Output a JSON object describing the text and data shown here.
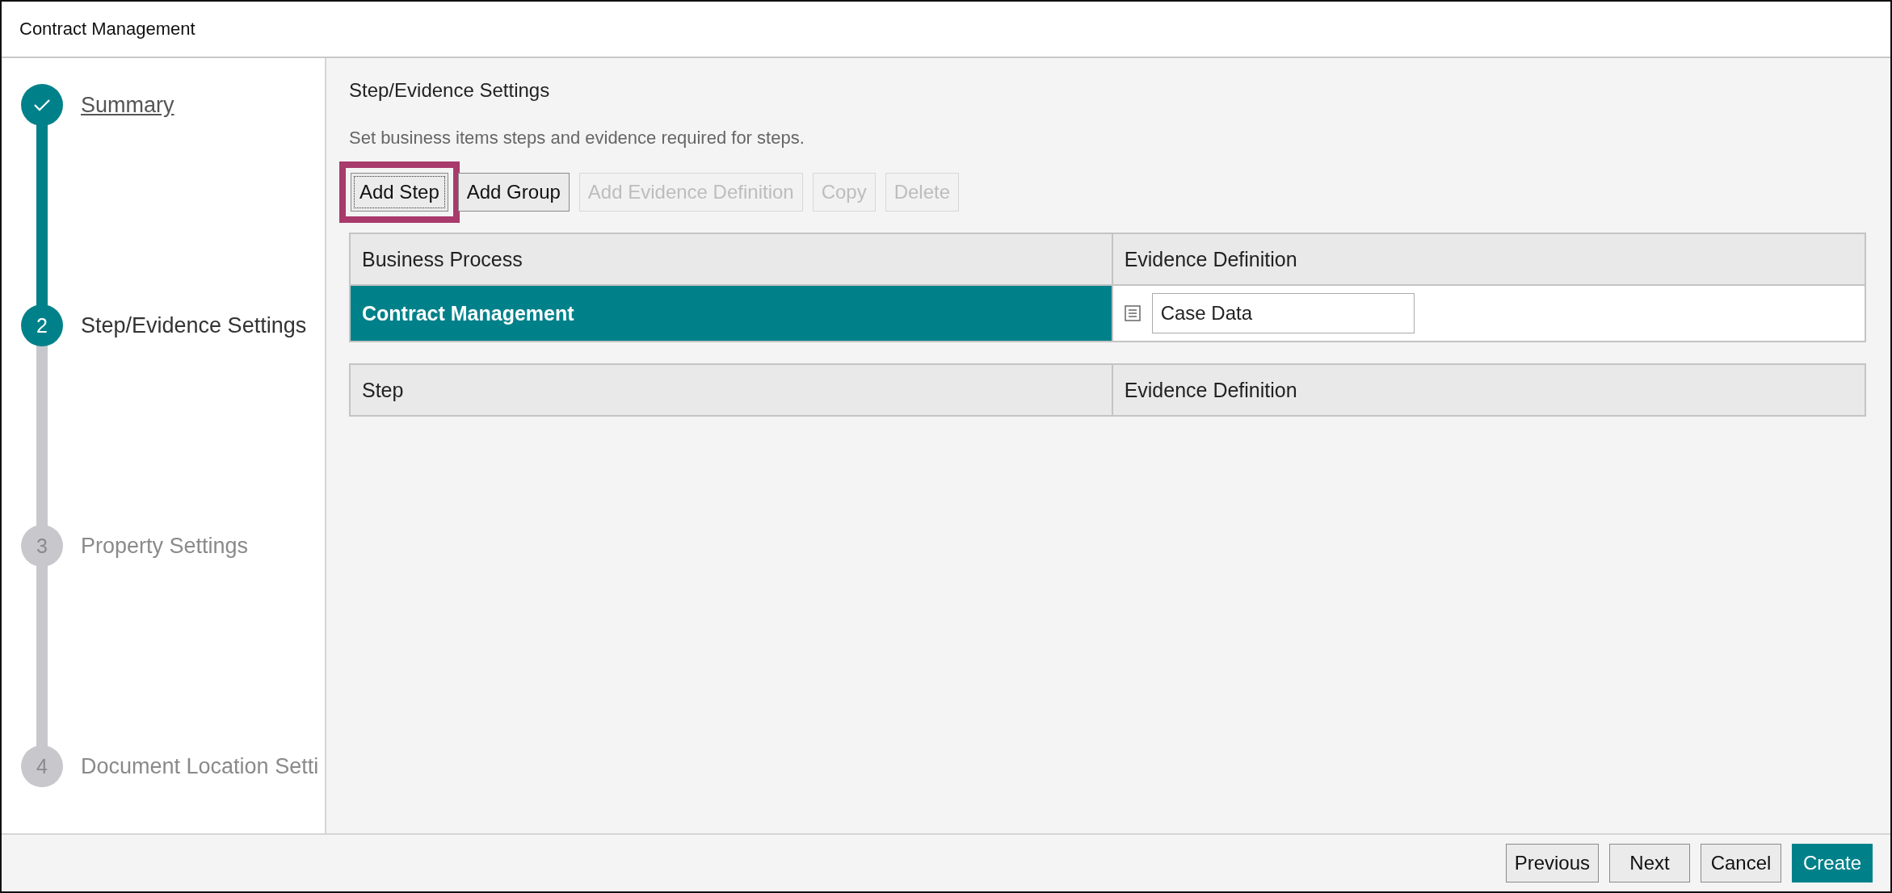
{
  "window": {
    "title": "Contract Management"
  },
  "steps": [
    {
      "kind": "done",
      "label": "Summary"
    },
    {
      "kind": "current",
      "number": "2",
      "label": "Step/Evidence Settings"
    },
    {
      "kind": "pending",
      "number": "3",
      "label": "Property Settings"
    },
    {
      "kind": "pending",
      "number": "4",
      "label": "Document Location Setti"
    }
  ],
  "panel": {
    "title": "Step/Evidence Settings",
    "description": "Set business items steps and evidence required for steps.",
    "toolbar": [
      {
        "label": "Add Step",
        "disabled": false,
        "highlighted": true
      },
      {
        "label": "Add Group",
        "disabled": false,
        "highlighted": false
      },
      {
        "label": "Add Evidence Definition",
        "disabled": true,
        "highlighted": false
      },
      {
        "label": "Copy",
        "disabled": true,
        "highlighted": false
      },
      {
        "label": "Delete",
        "disabled": true,
        "highlighted": false
      }
    ],
    "process_table": {
      "columns": [
        "Business Process",
        "Evidence Definition"
      ],
      "rows": [
        {
          "name": "Contract Management",
          "selected": true,
          "evidence": "Case Data"
        }
      ]
    },
    "step_table": {
      "columns": [
        "Step",
        "Evidence Definition"
      ]
    }
  },
  "footer": {
    "buttons": [
      {
        "label": "Previous",
        "kind": "normal"
      },
      {
        "label": "Next",
        "kind": "normal"
      },
      {
        "label": "Cancel",
        "kind": "normal"
      },
      {
        "label": "Create",
        "kind": "primary"
      }
    ]
  }
}
